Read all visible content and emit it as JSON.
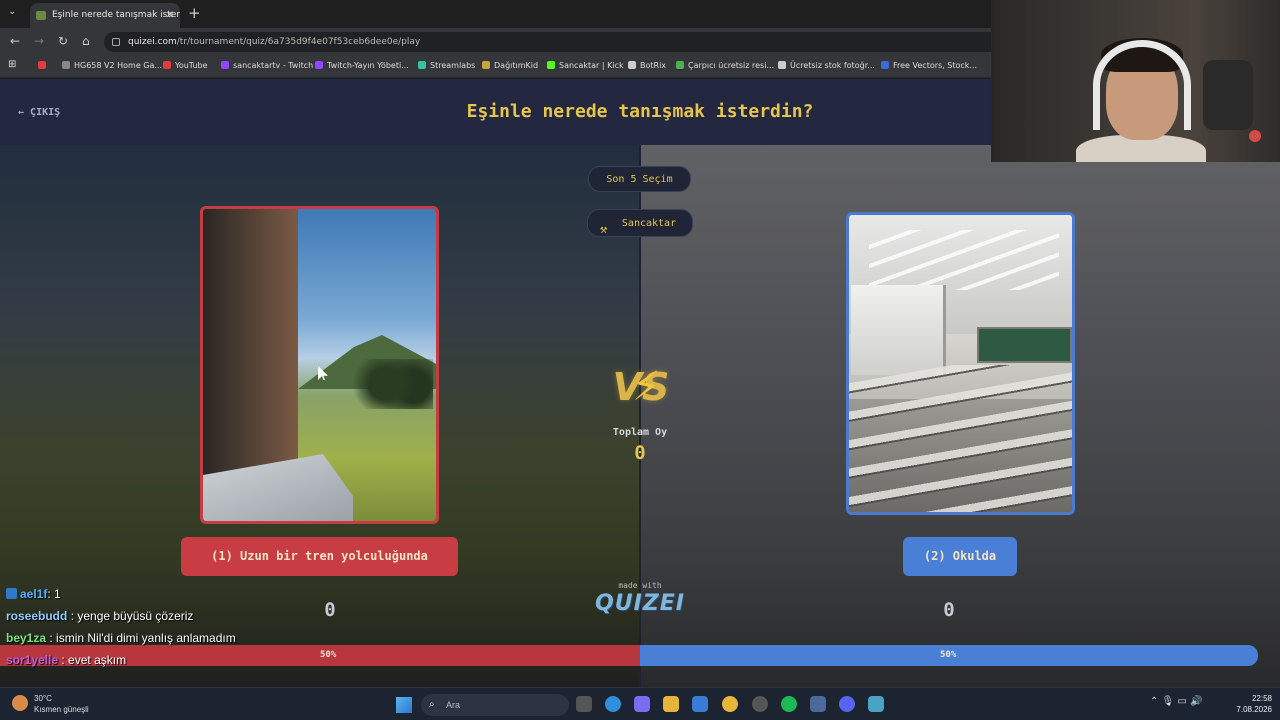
{
  "browser": {
    "tab_title": "Eşinle nerede tanışmak isterdin",
    "url_host": "quizei.com",
    "url_path": "/tr/tournament/quiz/6a735d9f4e07f53ceb6dee0e/play",
    "bookmarks": [
      {
        "label": "",
        "color": "#e33b3b"
      },
      {
        "label": "HG658 V2 Home Ga...",
        "color": "#888888"
      },
      {
        "label": "YouTube",
        "color": "#e33b3b"
      },
      {
        "label": "sancaktartv - Twitch",
        "color": "#9146ff"
      },
      {
        "label": "Twitch-Yayın Yöbeti...",
        "color": "#9146ff"
      },
      {
        "label": "Streamlabs",
        "color": "#31c3a2"
      },
      {
        "label": "DağıtımKid",
        "color": "#c9a43a"
      },
      {
        "label": "Sancaktar | Kick",
        "color": "#53fc18"
      },
      {
        "label": "BotRix",
        "color": "#cccccc"
      },
      {
        "label": "Çarpıcı ücretsiz resi...",
        "color": "#4caf50"
      },
      {
        "label": "Ücretsiz stok fotoğr...",
        "color": "#cccccc"
      },
      {
        "label": "Free Vectors, Stock...",
        "color": "#3b6bd6"
      }
    ]
  },
  "header": {
    "exit_label": "ÇIKIŞ",
    "title": "Eşinle nerede tanışmak isterdin?"
  },
  "center": {
    "last5_label": "Son 5 Seçim",
    "streamer_label": "Sancaktar",
    "vs_text": "VS",
    "total_label": "Toplam Oy",
    "total_value": "0",
    "made_with": "made with",
    "logo_text": "QUIZEI"
  },
  "choices": {
    "left": {
      "label": "(1) Uzun bir tren yolculuğunda",
      "votes": "0",
      "percent": "50%",
      "color": "#c83c44"
    },
    "right": {
      "label": "(2) Okulda",
      "votes": "0",
      "percent": "50%",
      "color": "#4a7fd6"
    }
  },
  "chat": [
    {
      "user": "ael1f",
      "text": ": 1",
      "color": "#4fb3ff",
      "badge": true
    },
    {
      "user": "roseebudd",
      "text": ": yenge büyüsü çözeriz",
      "color": "#8ec9ff",
      "badge": false
    },
    {
      "user": "bey1za",
      "text": ": ismin Nil'di dimi yanlış anlamadım",
      "color": "#7ce37c",
      "badge": false
    },
    {
      "user": "sor1yelle",
      "text": ": evet aşkım",
      "color": "#c060e0",
      "badge": false
    }
  ],
  "taskbar": {
    "temperature": "30°C",
    "weather": "Kısmen güneşli",
    "search_placeholder": "Ara",
    "time": "22:58",
    "date": "7.08.2026"
  }
}
